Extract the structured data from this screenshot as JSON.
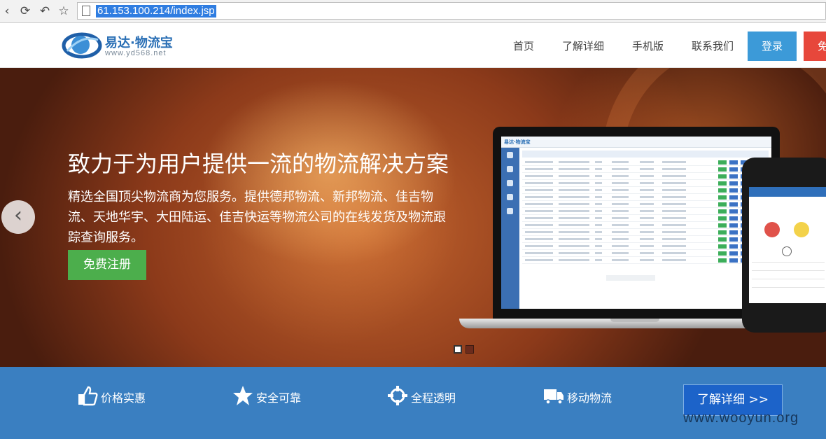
{
  "browser": {
    "url": "61.153.100.214/index.jsp",
    "icons": [
      "back-icon",
      "refresh-icon",
      "undo-icon",
      "star-icon",
      "page-icon"
    ]
  },
  "header": {
    "logo_name": "易达·物流宝",
    "logo_url": "www.yd568.net",
    "nav": [
      "首页",
      "了解详细",
      "手机版",
      "联系我们"
    ],
    "login_label": "登录",
    "register_label": "免"
  },
  "hero": {
    "headline": "致力于为用户提供一流的物流解决方案",
    "description": "精选全国顶尖物流商为您服务。提供德邦物流、新邦物流、佳吉物流、天地华宇、大田陆运、佳吉快运等物流公司的在线发货及物流跟踪查询服务。",
    "cta_label": "免费注册",
    "prev_icon": "chevron-left-icon"
  },
  "features": {
    "items": [
      {
        "icon": "thumbs-up-icon",
        "label": "价格实惠"
      },
      {
        "icon": "star-icon",
        "label": "安全可靠"
      },
      {
        "icon": "crosshair-icon",
        "label": "全程透明"
      },
      {
        "icon": "truck-icon",
        "label": "移动物流"
      }
    ],
    "learn_more_label": "了解详细 >>"
  },
  "watermark": "www.wooyun.org",
  "colors": {
    "accent_blue": "#3c9ad8",
    "feature_bar": "#3a7fc1",
    "cta_green": "#4cae4c",
    "register_red": "#e7473b",
    "learn_more_blue": "#1c63c9"
  }
}
